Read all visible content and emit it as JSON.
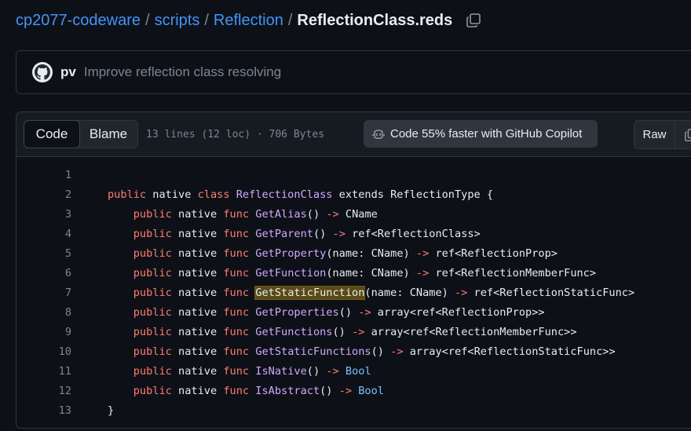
{
  "breadcrumb": {
    "repo": "cp2077-codeware",
    "folders": [
      "scripts",
      "Reflection"
    ],
    "separator": "/",
    "file": "ReflectionClass.reds"
  },
  "commit": {
    "author": "pv",
    "message": "Improve reflection class resolving"
  },
  "file_header": {
    "code_tab": "Code",
    "blame_tab": "Blame",
    "info": "13 lines (12 loc) · 706 Bytes",
    "copilot": "Code 55% faster with GitHub Copilot",
    "raw": "Raw"
  },
  "code": {
    "line_numbers": [
      "1",
      "2",
      "3",
      "4",
      "5",
      "6",
      "7",
      "8",
      "9",
      "10",
      "11",
      "12",
      "13"
    ],
    "lines": [
      [],
      [
        [
          "kw",
          "public"
        ],
        [
          "t",
          " native "
        ],
        [
          "kw",
          "class"
        ],
        [
          "t",
          " "
        ],
        [
          "fn",
          "ReflectionClass"
        ],
        [
          "t",
          " extends ReflectionType {"
        ]
      ],
      [
        [
          "t",
          "    "
        ],
        [
          "kw",
          "public"
        ],
        [
          "t",
          " native "
        ],
        [
          "kw",
          "func"
        ],
        [
          "t",
          " "
        ],
        [
          "fn",
          "GetAlias"
        ],
        [
          "t",
          "() "
        ],
        [
          "op",
          "->"
        ],
        [
          "t",
          " CName"
        ]
      ],
      [
        [
          "t",
          "    "
        ],
        [
          "kw",
          "public"
        ],
        [
          "t",
          " native "
        ],
        [
          "kw",
          "func"
        ],
        [
          "t",
          " "
        ],
        [
          "fn",
          "GetParent"
        ],
        [
          "t",
          "() "
        ],
        [
          "op",
          "->"
        ],
        [
          "t",
          " ref<ReflectionClass>"
        ]
      ],
      [
        [
          "t",
          "    "
        ],
        [
          "kw",
          "public"
        ],
        [
          "t",
          " native "
        ],
        [
          "kw",
          "func"
        ],
        [
          "t",
          " "
        ],
        [
          "fn",
          "GetProperty"
        ],
        [
          "t",
          "(name: CName) "
        ],
        [
          "op",
          "->"
        ],
        [
          "t",
          " ref<ReflectionProp>"
        ]
      ],
      [
        [
          "t",
          "    "
        ],
        [
          "kw",
          "public"
        ],
        [
          "t",
          " native "
        ],
        [
          "kw",
          "func"
        ],
        [
          "t",
          " "
        ],
        [
          "fn",
          "GetFunction"
        ],
        [
          "t",
          "(name: CName) "
        ],
        [
          "op",
          "->"
        ],
        [
          "t",
          " ref<ReflectionMemberFunc>"
        ]
      ],
      [
        [
          "t",
          "    "
        ],
        [
          "kw",
          "public"
        ],
        [
          "t",
          " native "
        ],
        [
          "kw",
          "func"
        ],
        [
          "t",
          " "
        ],
        [
          "hl",
          "GetStaticFunction"
        ],
        [
          "t",
          "(name: CName) "
        ],
        [
          "op",
          "->"
        ],
        [
          "t",
          " ref<ReflectionStaticFunc>"
        ]
      ],
      [
        [
          "t",
          "    "
        ],
        [
          "kw",
          "public"
        ],
        [
          "t",
          " native "
        ],
        [
          "kw",
          "func"
        ],
        [
          "t",
          " "
        ],
        [
          "fn",
          "GetProperties"
        ],
        [
          "t",
          "() "
        ],
        [
          "op",
          "->"
        ],
        [
          "t",
          " array<ref<ReflectionProp>>"
        ]
      ],
      [
        [
          "t",
          "    "
        ],
        [
          "kw",
          "public"
        ],
        [
          "t",
          " native "
        ],
        [
          "kw",
          "func"
        ],
        [
          "t",
          " "
        ],
        [
          "fn",
          "GetFunctions"
        ],
        [
          "t",
          "() "
        ],
        [
          "op",
          "->"
        ],
        [
          "t",
          " array<ref<ReflectionMemberFunc>>"
        ]
      ],
      [
        [
          "t",
          "    "
        ],
        [
          "kw",
          "public"
        ],
        [
          "t",
          " native "
        ],
        [
          "kw",
          "func"
        ],
        [
          "t",
          " "
        ],
        [
          "fn",
          "GetStaticFunctions"
        ],
        [
          "t",
          "() "
        ],
        [
          "op",
          "->"
        ],
        [
          "t",
          " array<ref<ReflectionStaticFunc>>"
        ]
      ],
      [
        [
          "t",
          "    "
        ],
        [
          "kw",
          "public"
        ],
        [
          "t",
          " native "
        ],
        [
          "kw",
          "func"
        ],
        [
          "t",
          " "
        ],
        [
          "fn",
          "IsNative"
        ],
        [
          "t",
          "() "
        ],
        [
          "op",
          "->"
        ],
        [
          "t",
          " "
        ],
        [
          "bool",
          "Bool"
        ]
      ],
      [
        [
          "t",
          "    "
        ],
        [
          "kw",
          "public"
        ],
        [
          "t",
          " native "
        ],
        [
          "kw",
          "func"
        ],
        [
          "t",
          " "
        ],
        [
          "fn",
          "IsAbstract"
        ],
        [
          "t",
          "() "
        ],
        [
          "op",
          "->"
        ],
        [
          "t",
          " "
        ],
        [
          "bool",
          "Bool"
        ]
      ],
      [
        [
          "t",
          "}"
        ]
      ]
    ]
  },
  "colors": {
    "background": "#0d1117",
    "link": "#4493f8",
    "keyword": "#ff7b72",
    "function": "#d2a8ff",
    "boolean": "#79c0ff",
    "highlight": "#5a4a15"
  }
}
